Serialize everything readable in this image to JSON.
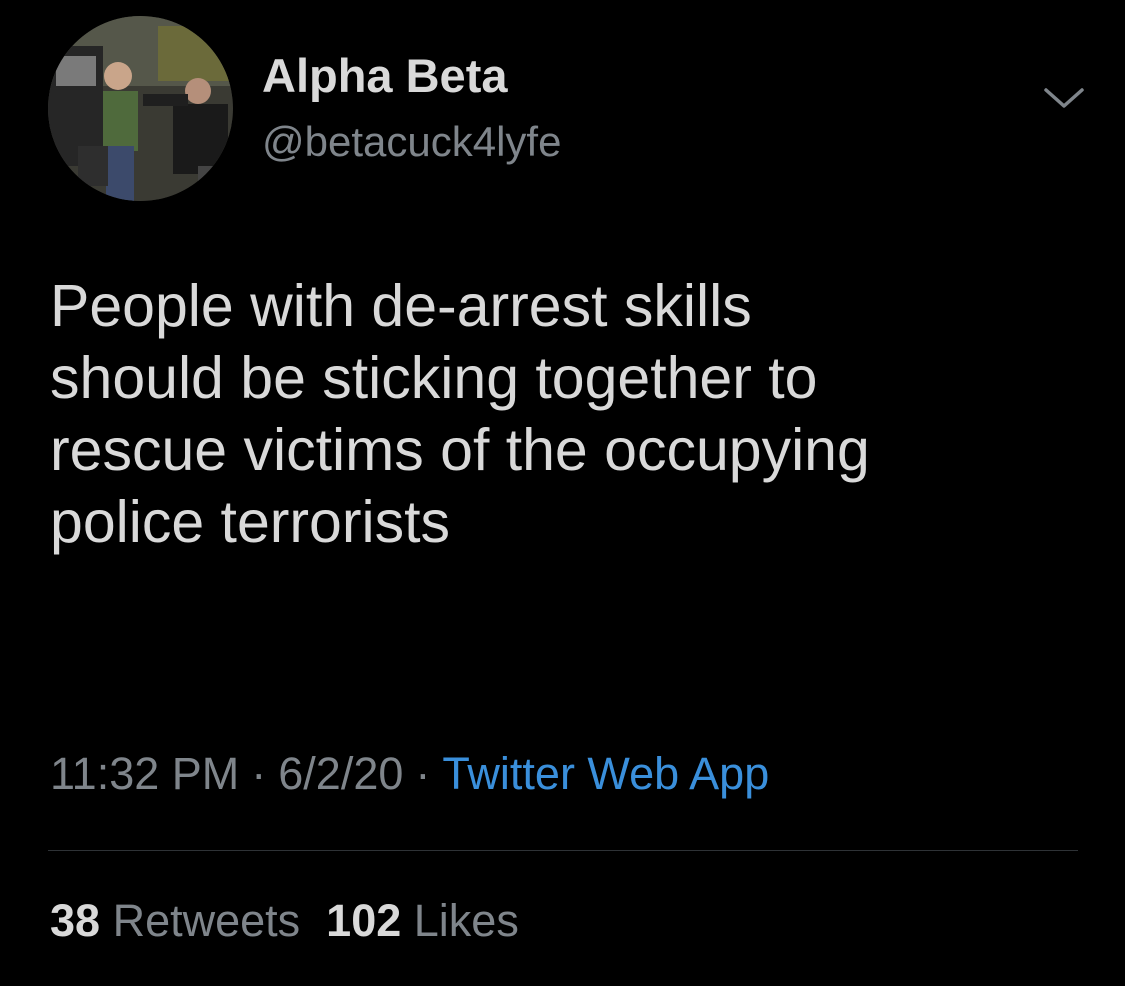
{
  "user": {
    "display_name": "Alpha Beta",
    "handle": "@betacuck4lyfe"
  },
  "tweet": {
    "text": "People with de-arrest skills\nshould be sticking together to\nrescue victims of the occupying\npolice terrorists"
  },
  "meta": {
    "time": "11:32 PM",
    "separator": "·",
    "date": "6/2/20",
    "source": "Twitter Web App"
  },
  "stats": {
    "retweets_count": "38",
    "retweets_label": "Retweets",
    "likes_count": "102",
    "likes_label": "Likes"
  },
  "icons": {
    "menu": "chevron-down-icon"
  },
  "colors": {
    "background": "#000000",
    "text": "#d9d9d9",
    "secondary": "#7f858b",
    "link": "#3a8fdb",
    "divider": "#2e3236"
  }
}
